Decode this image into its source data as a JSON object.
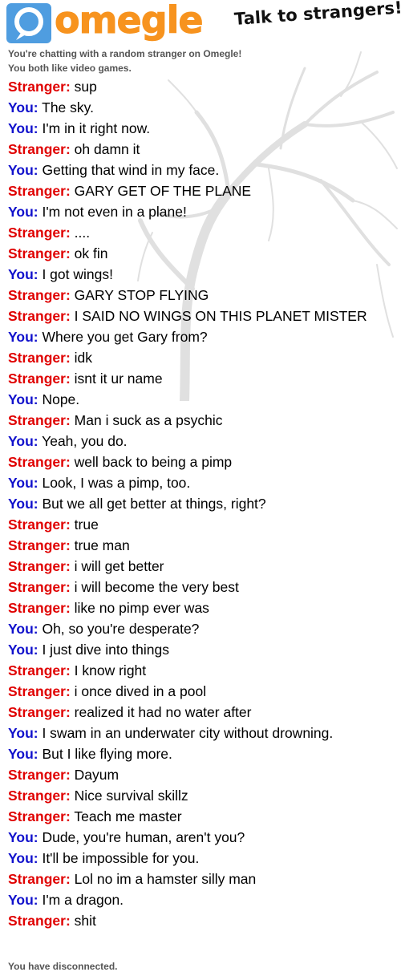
{
  "header": {
    "brand": "omegle",
    "tagline": "Talk to strangers!"
  },
  "status": {
    "top_line": "You're chatting with a random stranger on Omegle!",
    "interests_line": "You both like video games.",
    "bottom_line": "You have disconnected."
  },
  "colors": {
    "stranger": "#e00000",
    "you": "#1010cc",
    "brand_orange": "#f7931e",
    "logo_blue": "#4f9de0"
  },
  "icons": [
    "omegle-logo-icon",
    "tree-background-image"
  ],
  "messages": [
    {
      "sender": "Stranger",
      "text": "sup"
    },
    {
      "sender": "You",
      "text": "The sky."
    },
    {
      "sender": "You",
      "text": "I'm in it right now."
    },
    {
      "sender": "Stranger",
      "text": "oh damn it"
    },
    {
      "sender": "You",
      "text": "Getting that wind in my face."
    },
    {
      "sender": "Stranger",
      "text": "GARY GET OF THE PLANE"
    },
    {
      "sender": "You",
      "text": "I'm not even in a plane!"
    },
    {
      "sender": "Stranger",
      "text": "...."
    },
    {
      "sender": "Stranger",
      "text": "ok fin"
    },
    {
      "sender": "You",
      "text": "I got wings!"
    },
    {
      "sender": "Stranger",
      "text": "GARY STOP FLYING"
    },
    {
      "sender": "Stranger",
      "text": "I SAID NO WINGS ON THIS PLANET MISTER"
    },
    {
      "sender": "You",
      "text": "Where you get Gary from?"
    },
    {
      "sender": "Stranger",
      "text": "idk"
    },
    {
      "sender": "Stranger",
      "text": "isnt it ur name"
    },
    {
      "sender": "You",
      "text": "Nope."
    },
    {
      "sender": "Stranger",
      "text": "Man i suck as a psychic"
    },
    {
      "sender": "You",
      "text": "Yeah, you do."
    },
    {
      "sender": "Stranger",
      "text": "well back to being a pimp"
    },
    {
      "sender": "You",
      "text": "Look, I was a pimp, too."
    },
    {
      "sender": "You",
      "text": "But we all get better at things, right?"
    },
    {
      "sender": "Stranger",
      "text": "true"
    },
    {
      "sender": "Stranger",
      "text": "true man"
    },
    {
      "sender": "Stranger",
      "text": "i will get better"
    },
    {
      "sender": "Stranger",
      "text": "i will become the very best"
    },
    {
      "sender": "Stranger",
      "text": "like no pimp ever was"
    },
    {
      "sender": "You",
      "text": "Oh, so you're desperate?"
    },
    {
      "sender": "You",
      "text": "I just dive into things"
    },
    {
      "sender": "Stranger",
      "text": "I know right"
    },
    {
      "sender": "Stranger",
      "text": "i once dived in a pool"
    },
    {
      "sender": "Stranger",
      "text": "realized it had no water after"
    },
    {
      "sender": "You",
      "text": "I swam in an underwater city without drowning."
    },
    {
      "sender": "You",
      "text": "But I like flying more."
    },
    {
      "sender": "Stranger",
      "text": "Dayum"
    },
    {
      "sender": "Stranger",
      "text": "Nice survival skillz"
    },
    {
      "sender": "Stranger",
      "text": "Teach me master"
    },
    {
      "sender": "You",
      "text": "Dude, you're human, aren't you?"
    },
    {
      "sender": "You",
      "text": "It'll be impossible for you."
    },
    {
      "sender": "Stranger",
      "text": "Lol no im a hamster silly man"
    },
    {
      "sender": "You",
      "text": "I'm a dragon."
    },
    {
      "sender": "Stranger",
      "text": "shit"
    }
  ]
}
